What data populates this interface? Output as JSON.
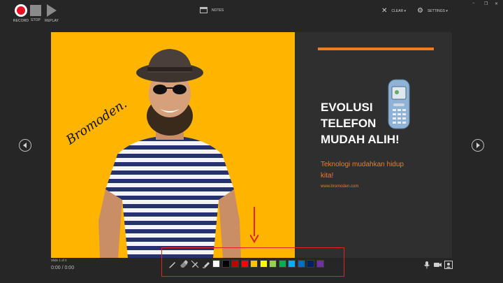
{
  "toolbar": {
    "record_label": "RECORD",
    "stop_label": "STOP",
    "replay_label": "REPLAY",
    "notes_label": "NOTES",
    "clear_label": "CLEAR ▾",
    "settings_label": "SETTINGS ▾"
  },
  "window": {
    "minimize_glyph": "−",
    "restore_glyph": "❐",
    "close_glyph": "✕"
  },
  "slide": {
    "title_lines": [
      "EVOLUSI",
      "TELEFON",
      "MUDAH ALIH!"
    ],
    "subtitle_lines": [
      "Teknologi mudahkan hidup",
      "kita!"
    ],
    "url": "www.bromoden.com",
    "signature": "Bromoden.",
    "colors": {
      "left_bg": "#ffb400",
      "right_bg": "#2f2f2f",
      "accent": "#ee7d21"
    }
  },
  "status": {
    "slide_counter": "Slide 1 of 2",
    "timer": "0:00 / 0:00"
  },
  "pen_tools": [
    {
      "name": "pen-tool-icon"
    },
    {
      "name": "eraser-icon"
    },
    {
      "name": "eraser-all-icon"
    },
    {
      "name": "highlighter-icon"
    }
  ],
  "colors": [
    "#ffffff",
    "#000000",
    "#c00000",
    "#ff0000",
    "#ffc000",
    "#ffff00",
    "#92d050",
    "#00b050",
    "#00b0f0",
    "#0070c0",
    "#002060",
    "#7030a0"
  ],
  "icons": {
    "microphone": "microphone-icon",
    "camera": "camera-icon",
    "camera_preview": "camera-preview-icon"
  }
}
